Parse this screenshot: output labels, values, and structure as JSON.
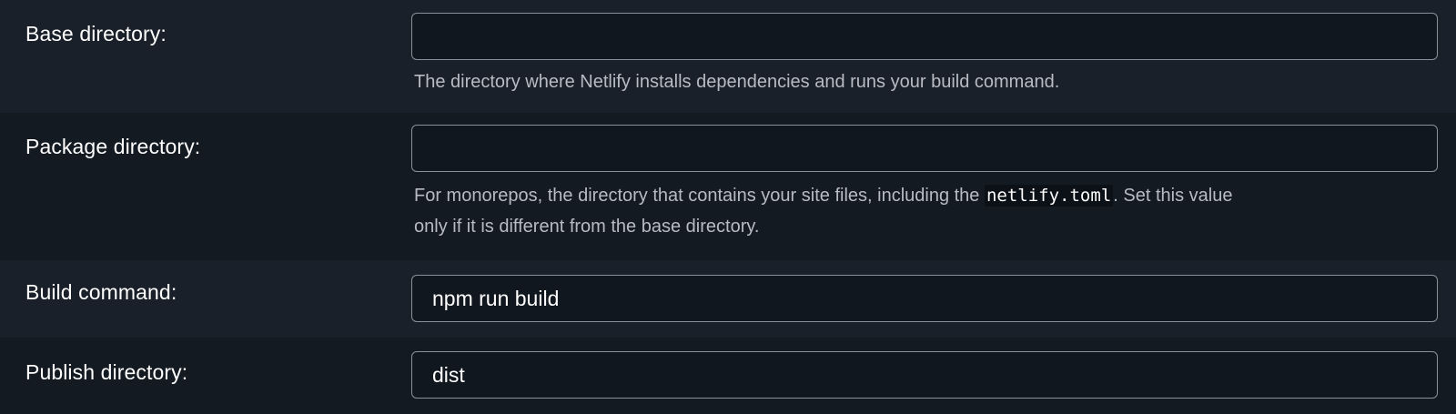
{
  "rows": [
    {
      "label": "Base directory:",
      "value": "",
      "help": "The directory where Netlify installs dependencies and runs your build command."
    },
    {
      "label": "Package directory:",
      "value": "",
      "help_before": "For monorepos, the directory that contains your site files, including the ",
      "help_code": "netlify.toml",
      "help_after": ". Set this value",
      "help_line2": "only if it is different from the base directory."
    },
    {
      "label": "Build command:",
      "value": "npm run build"
    },
    {
      "label": "Publish directory:",
      "value": "dist"
    }
  ]
}
